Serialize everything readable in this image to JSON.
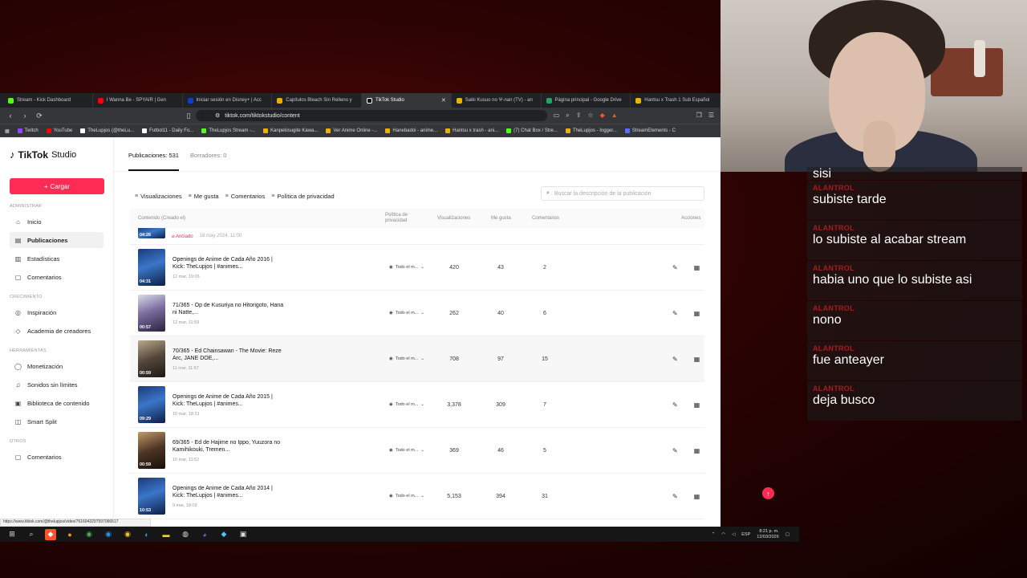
{
  "browser": {
    "tabs": [
      {
        "title": "Stream - Kick Dashboard",
        "color": "#53fc18"
      },
      {
        "title": "I Wanna Be - SPYAIR | Gen",
        "color": "#ff0000"
      },
      {
        "title": "Iniciar sesión en Disney+ | Acc",
        "color": "#113ccf"
      },
      {
        "title": "Capítulos Bleach Sin Relleno y",
        "color": "#f2a900"
      },
      {
        "title": "TikTok Studio",
        "color": "#ffffff",
        "active": true
      },
      {
        "title": "Saiki Kusuo no Ψ-nan (TV) - an",
        "color": "#e8b400"
      },
      {
        "title": "Página principal - Google Drive",
        "color": "#1fa463"
      },
      {
        "title": "Hantsu x Trash 1 Sub Español",
        "color": "#e8b400"
      }
    ],
    "url": "tiktok.com/tiktokstudio/content",
    "bookmarks": [
      {
        "label": "Twitch",
        "color": "#9146ff"
      },
      {
        "label": "YouTube",
        "color": "#ff0000"
      },
      {
        "label": "TheLupjos (@theLu...",
        "color": "#ffffff"
      },
      {
        "label": "Futbol11 - Daily Fo...",
        "color": "#ffffff"
      },
      {
        "label": "TheLupjos Stream -...",
        "color": "#53fc18"
      },
      {
        "label": "Kanpekisugite Kawa...",
        "color": "#e8b400"
      },
      {
        "label": "Ver Anime Online -...",
        "color": "#e8b400"
      },
      {
        "label": "Hanebadoi - anime...",
        "color": "#e8b400"
      },
      {
        "label": "Hantsu x trash - ani...",
        "color": "#e8b400"
      },
      {
        "label": "(7) Chat Box / Stre...",
        "color": "#53fc18"
      },
      {
        "label": "TheLupjos - Ingger...",
        "color": "#e8b400"
      },
      {
        "label": "StreamElements - C",
        "color": "#5b6cff"
      }
    ],
    "status_url": "https://www.tiktok.com/@thelupjos/video/7616043297597066517"
  },
  "studio": {
    "logo_brand": "TikTok",
    "logo_suffix": "Studio",
    "upload_label": "Cargar",
    "sections": {
      "admin": "ADMINISTRAR",
      "growth": "CRECIMIENTO",
      "tools": "HERRAMIENTAS",
      "others": "OTROS"
    },
    "nav": {
      "home": "Inicio",
      "posts": "Publicaciones",
      "analytics": "Estadísticas",
      "comments": "Comentarios",
      "inspiration": "Inspiración",
      "academy": "Academia de creadores",
      "monetization": "Monetización",
      "sounds": "Sonidos sin límites",
      "content_library": "Biblioteca de contenido",
      "smart_split": "Smart Split",
      "comments2": "Comentarios"
    },
    "top_tabs": {
      "published": "Publicaciones: 531",
      "drafts": "Borradores: 0"
    },
    "filters": {
      "views": "Visualizaciones",
      "likes": "Me gusta",
      "comments": "Comentarios",
      "privacy": "Política de privacidad"
    },
    "search_placeholder": "Buscar la descripción de la publicación",
    "columns": {
      "content": "Contenido (Creado el)",
      "privacy": "Política de privacidad",
      "views": "Visualizaciones",
      "likes": "Me gusta",
      "comments": "Comentarios",
      "actions": "Acciones"
    },
    "pinned": {
      "duration": "04:26",
      "badge": "Anclado",
      "date": "18 may 2024, 11:00"
    },
    "videos": [
      {
        "title": "Openings de Anime de Cada Año 2016 | Kick: TheLupjos | #animes...",
        "date": "12 mar, 19:06",
        "duration": "04:31",
        "privacy": "Todo el m...",
        "views": "420",
        "likes": "43",
        "comments": "2"
      },
      {
        "title": "71/365 - Op de Kusuriya no Hitorigoto, Hana ni Natte,...",
        "date": "12 mar, 11:59",
        "duration": "00:57",
        "privacy": "Todo el m...",
        "views": "262",
        "likes": "40",
        "comments": "6"
      },
      {
        "title": "70/365 - Ed Chainsawan - The Movie: Reze Arc, JANE DOE,...",
        "date": "11 mar, 11:57",
        "duration": "00:59",
        "privacy": "Todo el m...",
        "views": "708",
        "likes": "97",
        "comments": "15"
      },
      {
        "title": "Openings de Anime de Cada Año 2015 | Kick: TheLupjos | #animes...",
        "date": "10 mar, 18:31",
        "duration": "09:29",
        "privacy": "Todo el m...",
        "views": "3,378",
        "likes": "309",
        "comments": "7"
      },
      {
        "title": "69/365 - Ed de Hajime no Ippo, Yuuzora no Kamihikouki, Tremen...",
        "date": "10 mar, 11:52",
        "duration": "00:59",
        "privacy": "Todo el m...",
        "views": "369",
        "likes": "46",
        "comments": "5"
      },
      {
        "title": "Openings de Anime de Cada Año 2014 | Kick: TheLupjos | #animes...",
        "date": "9 mar, 18:03",
        "duration": "10:53",
        "privacy": "Todo el m...",
        "views": "5,153",
        "likes": "394",
        "comments": "31"
      }
    ]
  },
  "taskbar": {
    "lang": "ESP",
    "time": "8:21 p. m.",
    "date": "12/03/2026"
  },
  "chat": {
    "messages": [
      {
        "user": "",
        "text": "sisi"
      },
      {
        "user": "ALANTROL",
        "text": "subiste tarde"
      },
      {
        "user": "ALANTROL",
        "text": "lo subiste al acabar stream"
      },
      {
        "user": "ALANTROL",
        "text": "habia uno que lo subiste asi"
      },
      {
        "user": "ALANTROL",
        "text": "nono"
      },
      {
        "user": "ALANTROL",
        "text": "fue anteayer"
      },
      {
        "user": "ALANTROL",
        "text": "deja busco"
      }
    ]
  },
  "colors": {
    "accent": "#fe2c55",
    "chat_user": "#a31d1d",
    "background": "#3a0505"
  }
}
